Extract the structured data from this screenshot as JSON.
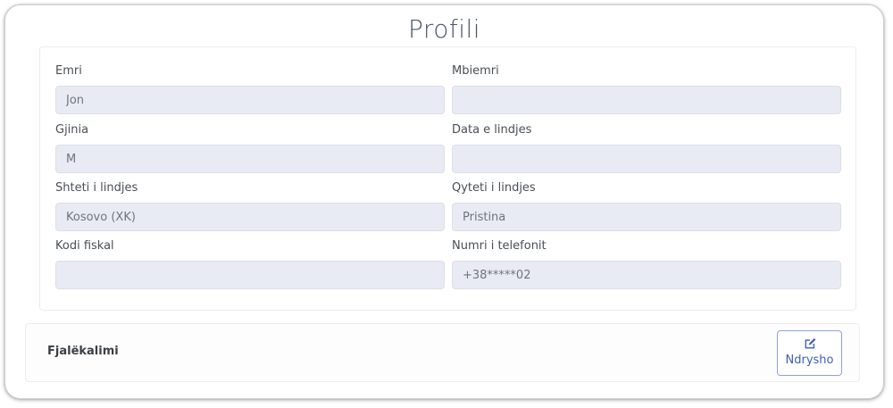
{
  "profile": {
    "title": "Profili",
    "fields": [
      {
        "label": "Emri",
        "value": "Jon"
      },
      {
        "label": "Mbiemri",
        "value": ""
      },
      {
        "label": "Gjinia",
        "value": "M"
      },
      {
        "label": "Data e lindjes",
        "value": ""
      },
      {
        "label": "Shteti i lindjes",
        "value": "Kosovo (XK)"
      },
      {
        "label": "Qyteti i lindjes",
        "value": "Pristina"
      },
      {
        "label": "Kodi fiskal",
        "value": ""
      },
      {
        "label": "Numri i telefonit",
        "value": "+38*****02"
      }
    ]
  },
  "password": {
    "label": "Fjalëkalimi",
    "button_label": "Ndrysho",
    "button_icon": "edit-icon"
  },
  "colors": {
    "accent": "#3f5fb8",
    "input_bg": "#e9ebf4"
  }
}
